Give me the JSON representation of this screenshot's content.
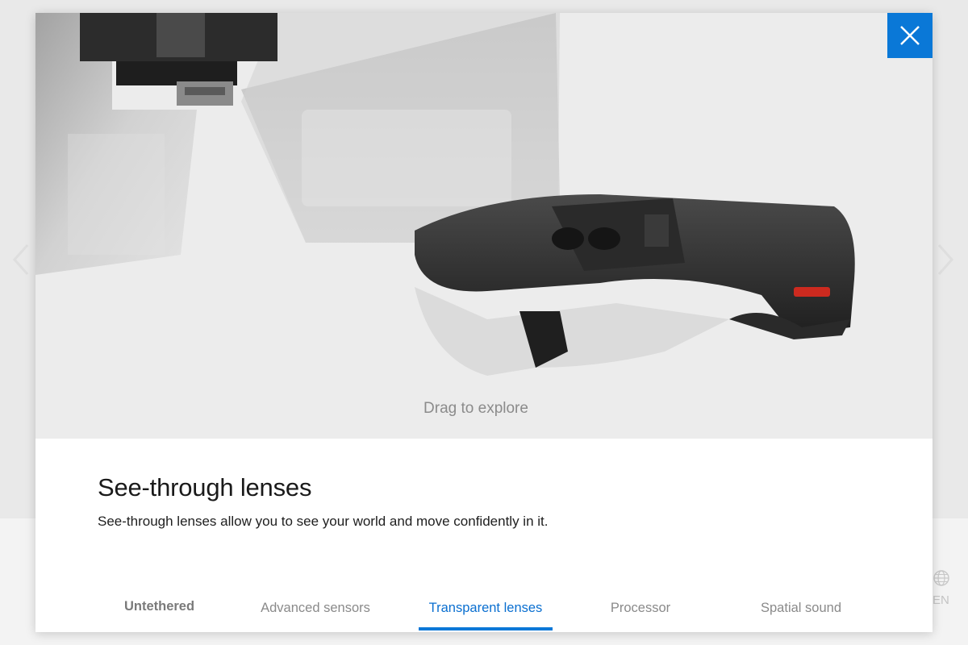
{
  "viewer": {
    "drag_hint": "Drag to explore",
    "image_subject": "HoloLens headset cutaway with see-through lenses"
  },
  "close_button": {
    "icon": "close-icon",
    "color": "#0a78d7"
  },
  "feature": {
    "title": "See-through lenses",
    "description": "See-through lenses allow you to see your world and move confidently in it."
  },
  "tabs": [
    {
      "label": "Untethered",
      "active": false
    },
    {
      "label": "Advanced sensors",
      "active": false
    },
    {
      "label": "Transparent lenses",
      "active": true
    },
    {
      "label": "Processor",
      "active": false
    },
    {
      "label": "Spatial sound",
      "active": false
    }
  ],
  "background": {
    "language_label": "EN",
    "language_icon": "globe-icon"
  },
  "colors": {
    "accent": "#0a78d7",
    "viewer_bg": "#ececec",
    "text": "#1a1a1a"
  }
}
